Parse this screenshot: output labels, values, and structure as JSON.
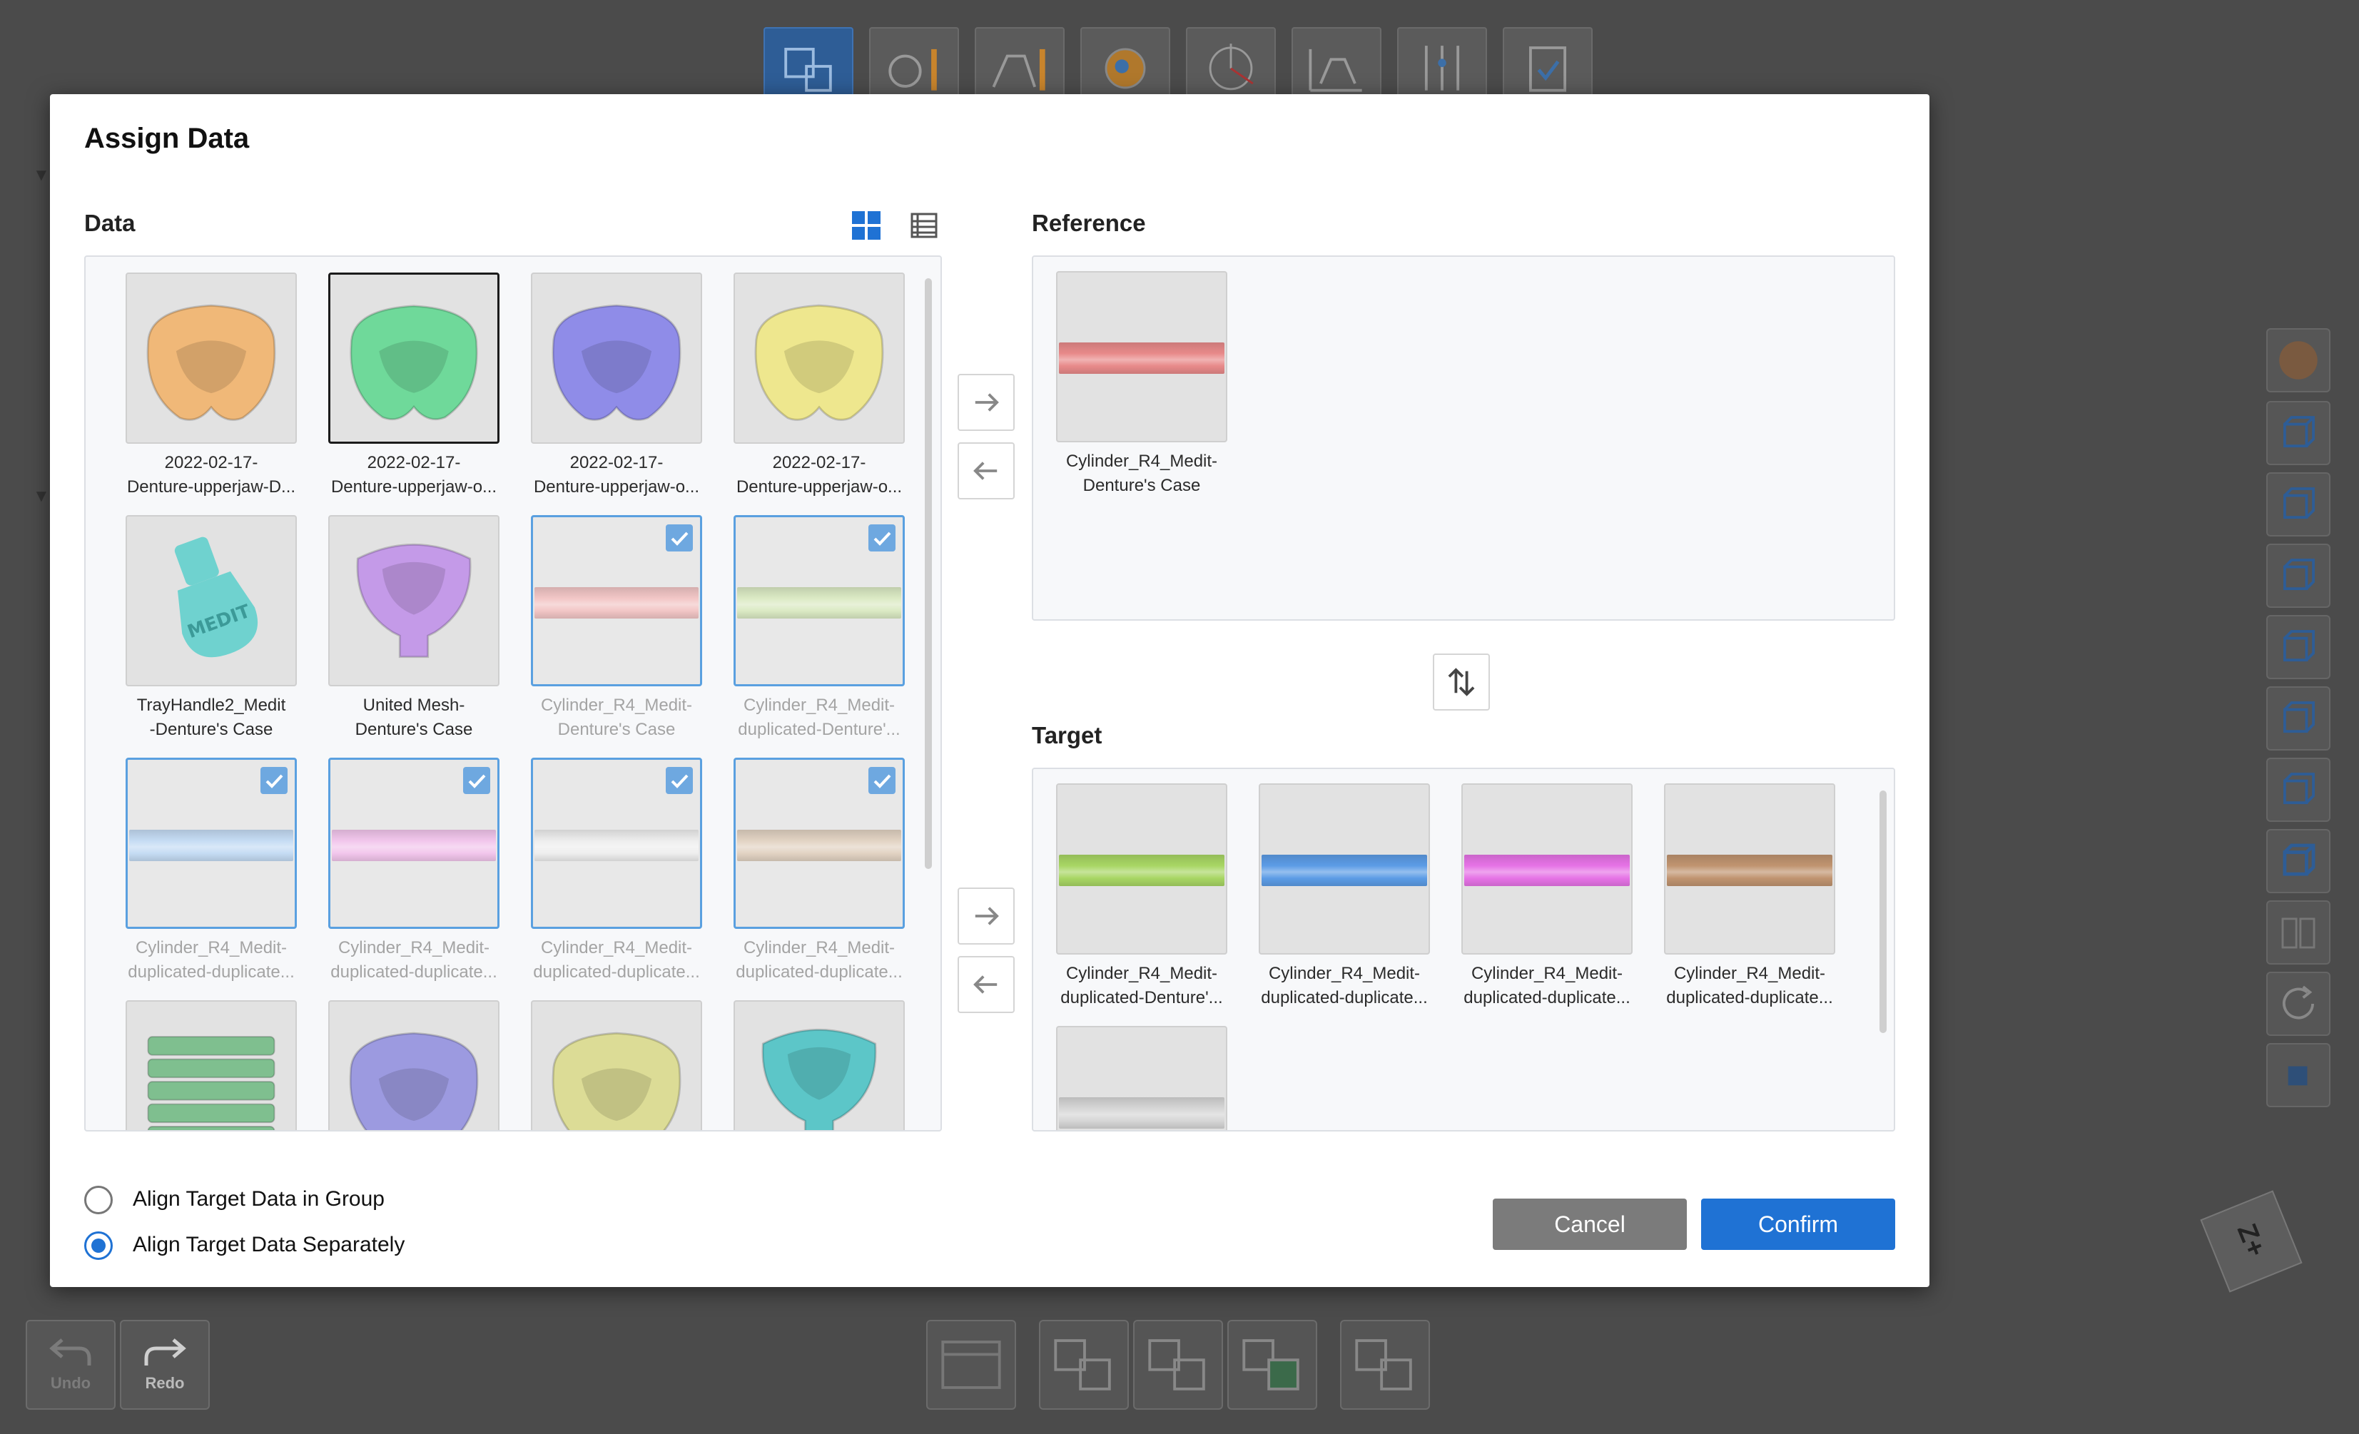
{
  "dialog": {
    "title": "Assign Data",
    "data_label": "Data",
    "reference_label": "Reference",
    "target_label": "Target",
    "align_group_label": "Align Target Data in Group",
    "align_separately_label": "Align Target Data Separately",
    "align_selected": "Align Target Data Separately",
    "cancel_label": "Cancel",
    "confirm_label": "Confirm"
  },
  "data_items": [
    {
      "line1": "2022-02-17-",
      "line2": "Denture-upperjaw-D...",
      "kind": "jaw",
      "color": "#f0b878"
    },
    {
      "line1": "2022-02-17-",
      "line2": "Denture-upperjaw-o...",
      "kind": "jaw",
      "color": "#6fd99a",
      "selected": true
    },
    {
      "line1": "2022-02-17-",
      "line2": "Denture-upperjaw-o...",
      "kind": "jaw",
      "color": "#8f8ce8"
    },
    {
      "line1": "2022-02-17-",
      "line2": "Denture-upperjaw-o...",
      "kind": "jaw",
      "color": "#eee78e"
    },
    {
      "line1": "TrayHandle2_Medit",
      "line2": "-Denture's Case",
      "kind": "handle",
      "color": "#6fd2cf"
    },
    {
      "line1": "United Mesh-",
      "line2": "Denture's Case",
      "kind": "tray",
      "color": "#c49ae8"
    },
    {
      "line1": "Cylinder_R4_Medit-",
      "line2": "Denture's Case",
      "kind": "cylinder",
      "color": "#f2c6c6",
      "checked": true
    },
    {
      "line1": "Cylinder_R4_Medit-",
      "line2": "duplicated-Denture'...",
      "kind": "cylinder",
      "color": "#dbeac4",
      "checked": true
    },
    {
      "line1": "Cylinder_R4_Medit-",
      "line2": "duplicated-duplicate...",
      "kind": "cylinder",
      "color": "#c5dcf4",
      "checked": true
    },
    {
      "line1": "Cylinder_R4_Medit-",
      "line2": "duplicated-duplicate...",
      "kind": "cylinder",
      "color": "#f2c6ec",
      "checked": true
    },
    {
      "line1": "Cylinder_R4_Medit-",
      "line2": "duplicated-duplicate...",
      "kind": "cylinder",
      "color": "#eeeeee",
      "checked": true
    },
    {
      "line1": "Cylinder_R4_Medit-",
      "line2": "duplicated-duplicate...",
      "kind": "cylinder",
      "color": "#e2d3c3",
      "checked": true
    },
    {
      "line1": "",
      "line2": "",
      "kind": "rods",
      "color": "#7fbf8f"
    },
    {
      "line1": "",
      "line2": "",
      "kind": "jaw",
      "color": "#9c9ae0"
    },
    {
      "line1": "",
      "line2": "",
      "kind": "jaw",
      "color": "#dcdc96"
    },
    {
      "line1": "",
      "line2": "",
      "kind": "tray",
      "color": "#5cc6c8"
    }
  ],
  "reference_items": [
    {
      "line1": "Cylinder_R4_Medit-",
      "line2": "Denture's Case",
      "color": "#e88a8a"
    }
  ],
  "target_items": [
    {
      "line1": "Cylinder_R4_Medit-",
      "line2": "duplicated-Denture'...",
      "color": "#a8d664"
    },
    {
      "line1": "Cylinder_R4_Medit-",
      "line2": "duplicated-duplicate...",
      "color": "#5c9ce6"
    },
    {
      "line1": "Cylinder_R4_Medit-",
      "line2": "duplicated-duplicate...",
      "color": "#e673e6"
    },
    {
      "line1": "Cylinder_R4_Medit-",
      "line2": "duplicated-duplicate...",
      "color": "#c09470"
    },
    {
      "line1": "",
      "line2": "",
      "color": "#d6d6d6"
    }
  ],
  "toolbar_bottom": {
    "undo_label": "Undo",
    "redo_label": "Redo"
  },
  "view_cube_label": "Z+",
  "colors": {
    "accent": "#1f72d4",
    "cancel": "#7b7b7b",
    "check": "#6ea8e0"
  }
}
